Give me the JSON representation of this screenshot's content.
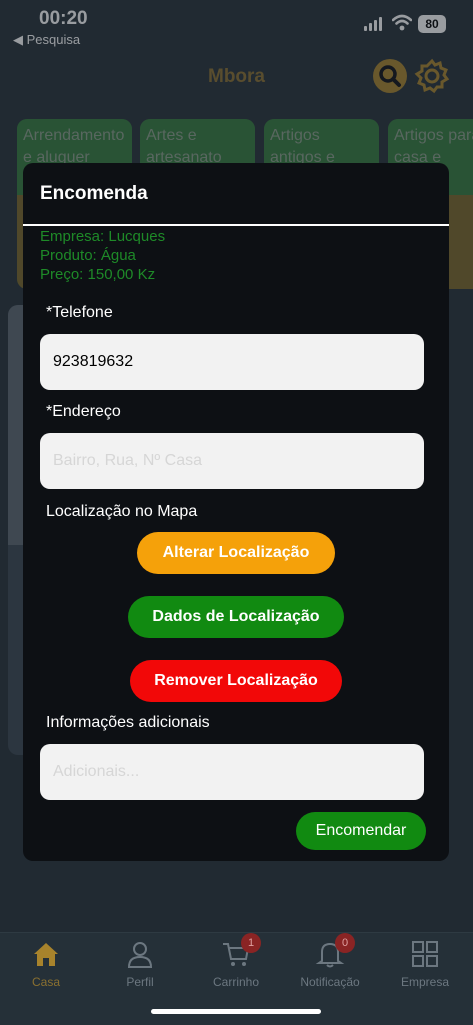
{
  "status": {
    "time": "00:20",
    "back_label": "◀ Pesquisa",
    "battery": "80"
  },
  "header": {
    "title": "Mbora"
  },
  "categories": [
    {
      "label": "Arrendamento e aluguer"
    },
    {
      "label": "Artes e artesanato"
    },
    {
      "label": "Artigos antigos e"
    },
    {
      "label": "Artigos para casa e"
    }
  ],
  "modal": {
    "title": "Encomenda",
    "empresa": "Empresa: Lucques",
    "produto": "Produto: Água",
    "preco": "Preço: 150,00 Kz",
    "telefone_label": "*Telefone",
    "telefone_value": "923819632",
    "endereco_label": "*Endereço",
    "endereco_placeholder": "Bairro, Rua, Nº Casa",
    "mapa_label": "Localização no Mapa",
    "alterar_label": "Alterar Localização",
    "dados_label": "Dados de Localização",
    "remover_label": "Remover Localização",
    "info_label": "Informações adicionais",
    "info_placeholder": "Adicionais...",
    "submit_label": "Encomendar"
  },
  "nav": {
    "items": [
      {
        "label": "Casa",
        "icon": "home-icon"
      },
      {
        "label": "Perfil",
        "icon": "user-icon"
      },
      {
        "label": "Carrinho",
        "icon": "cart-icon",
        "badge": "1"
      },
      {
        "label": "Notificação",
        "icon": "bell-icon",
        "badge": "0"
      },
      {
        "label": "Empresa",
        "icon": "grid-icon"
      }
    ]
  }
}
